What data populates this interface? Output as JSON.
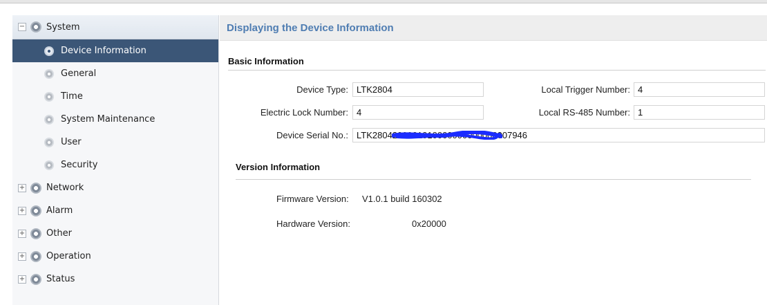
{
  "sidebar": {
    "root": {
      "label": "System",
      "toggle": "−"
    },
    "children": [
      {
        "label": "Device Information",
        "active": true
      },
      {
        "label": "General",
        "active": false
      },
      {
        "label": "Time",
        "active": false
      },
      {
        "label": "System Maintenance",
        "active": false
      },
      {
        "label": "User",
        "active": false
      },
      {
        "label": "Security",
        "active": false
      }
    ],
    "groups": [
      {
        "label": "Network",
        "toggle": "+"
      },
      {
        "label": "Alarm",
        "toggle": "+"
      },
      {
        "label": "Other",
        "toggle": "+"
      },
      {
        "label": "Operation",
        "toggle": "+"
      },
      {
        "label": "Status",
        "toggle": "+"
      }
    ]
  },
  "main": {
    "header": "Displaying the Device Information",
    "basic_title": "Basic Information",
    "fields": {
      "device_type": {
        "label": "Device Type:",
        "value": "LTK2804"
      },
      "local_trigger": {
        "label": "Local Trigger Number:",
        "value": "4"
      },
      "electric_lock": {
        "label": "Electric Lock Number:",
        "value": "4"
      },
      "local_rs485": {
        "label": "Local RS-485 Number:",
        "value": "1"
      },
      "serial": {
        "label": "Device Serial No.:",
        "value": "LTK2804209901010000000000000007946"
      }
    },
    "version_title": "Version Information",
    "firmware": {
      "label": "Firmware Version:",
      "value": "V1.0.1 build 160302"
    },
    "hardware": {
      "label": "Hardware Version:",
      "value": "0x20000"
    }
  },
  "colors": {
    "accent": "#4f7db2",
    "active_bg": "#3b5677",
    "redaction": "#1b2cff"
  }
}
